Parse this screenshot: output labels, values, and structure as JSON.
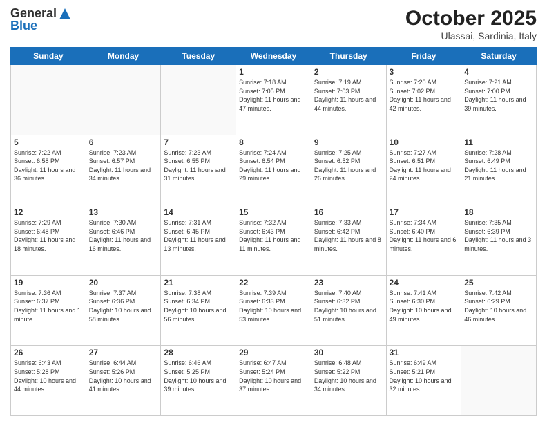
{
  "header": {
    "logo_general": "General",
    "logo_blue": "Blue",
    "title": "October 2025",
    "subtitle": "Ulassai, Sardinia, Italy"
  },
  "days_of_week": [
    "Sunday",
    "Monday",
    "Tuesday",
    "Wednesday",
    "Thursday",
    "Friday",
    "Saturday"
  ],
  "weeks": [
    [
      {
        "day": "",
        "info": ""
      },
      {
        "day": "",
        "info": ""
      },
      {
        "day": "",
        "info": ""
      },
      {
        "day": "1",
        "info": "Sunrise: 7:18 AM\nSunset: 7:05 PM\nDaylight: 11 hours and 47 minutes."
      },
      {
        "day": "2",
        "info": "Sunrise: 7:19 AM\nSunset: 7:03 PM\nDaylight: 11 hours and 44 minutes."
      },
      {
        "day": "3",
        "info": "Sunrise: 7:20 AM\nSunset: 7:02 PM\nDaylight: 11 hours and 42 minutes."
      },
      {
        "day": "4",
        "info": "Sunrise: 7:21 AM\nSunset: 7:00 PM\nDaylight: 11 hours and 39 minutes."
      }
    ],
    [
      {
        "day": "5",
        "info": "Sunrise: 7:22 AM\nSunset: 6:58 PM\nDaylight: 11 hours and 36 minutes."
      },
      {
        "day": "6",
        "info": "Sunrise: 7:23 AM\nSunset: 6:57 PM\nDaylight: 11 hours and 34 minutes."
      },
      {
        "day": "7",
        "info": "Sunrise: 7:23 AM\nSunset: 6:55 PM\nDaylight: 11 hours and 31 minutes."
      },
      {
        "day": "8",
        "info": "Sunrise: 7:24 AM\nSunset: 6:54 PM\nDaylight: 11 hours and 29 minutes."
      },
      {
        "day": "9",
        "info": "Sunrise: 7:25 AM\nSunset: 6:52 PM\nDaylight: 11 hours and 26 minutes."
      },
      {
        "day": "10",
        "info": "Sunrise: 7:27 AM\nSunset: 6:51 PM\nDaylight: 11 hours and 24 minutes."
      },
      {
        "day": "11",
        "info": "Sunrise: 7:28 AM\nSunset: 6:49 PM\nDaylight: 11 hours and 21 minutes."
      }
    ],
    [
      {
        "day": "12",
        "info": "Sunrise: 7:29 AM\nSunset: 6:48 PM\nDaylight: 11 hours and 18 minutes."
      },
      {
        "day": "13",
        "info": "Sunrise: 7:30 AM\nSunset: 6:46 PM\nDaylight: 11 hours and 16 minutes."
      },
      {
        "day": "14",
        "info": "Sunrise: 7:31 AM\nSunset: 6:45 PM\nDaylight: 11 hours and 13 minutes."
      },
      {
        "day": "15",
        "info": "Sunrise: 7:32 AM\nSunset: 6:43 PM\nDaylight: 11 hours and 11 minutes."
      },
      {
        "day": "16",
        "info": "Sunrise: 7:33 AM\nSunset: 6:42 PM\nDaylight: 11 hours and 8 minutes."
      },
      {
        "day": "17",
        "info": "Sunrise: 7:34 AM\nSunset: 6:40 PM\nDaylight: 11 hours and 6 minutes."
      },
      {
        "day": "18",
        "info": "Sunrise: 7:35 AM\nSunset: 6:39 PM\nDaylight: 11 hours and 3 minutes."
      }
    ],
    [
      {
        "day": "19",
        "info": "Sunrise: 7:36 AM\nSunset: 6:37 PM\nDaylight: 11 hours and 1 minute."
      },
      {
        "day": "20",
        "info": "Sunrise: 7:37 AM\nSunset: 6:36 PM\nDaylight: 10 hours and 58 minutes."
      },
      {
        "day": "21",
        "info": "Sunrise: 7:38 AM\nSunset: 6:34 PM\nDaylight: 10 hours and 56 minutes."
      },
      {
        "day": "22",
        "info": "Sunrise: 7:39 AM\nSunset: 6:33 PM\nDaylight: 10 hours and 53 minutes."
      },
      {
        "day": "23",
        "info": "Sunrise: 7:40 AM\nSunset: 6:32 PM\nDaylight: 10 hours and 51 minutes."
      },
      {
        "day": "24",
        "info": "Sunrise: 7:41 AM\nSunset: 6:30 PM\nDaylight: 10 hours and 49 minutes."
      },
      {
        "day": "25",
        "info": "Sunrise: 7:42 AM\nSunset: 6:29 PM\nDaylight: 10 hours and 46 minutes."
      }
    ],
    [
      {
        "day": "26",
        "info": "Sunrise: 6:43 AM\nSunset: 5:28 PM\nDaylight: 10 hours and 44 minutes."
      },
      {
        "day": "27",
        "info": "Sunrise: 6:44 AM\nSunset: 5:26 PM\nDaylight: 10 hours and 41 minutes."
      },
      {
        "day": "28",
        "info": "Sunrise: 6:46 AM\nSunset: 5:25 PM\nDaylight: 10 hours and 39 minutes."
      },
      {
        "day": "29",
        "info": "Sunrise: 6:47 AM\nSunset: 5:24 PM\nDaylight: 10 hours and 37 minutes."
      },
      {
        "day": "30",
        "info": "Sunrise: 6:48 AM\nSunset: 5:22 PM\nDaylight: 10 hours and 34 minutes."
      },
      {
        "day": "31",
        "info": "Sunrise: 6:49 AM\nSunset: 5:21 PM\nDaylight: 10 hours and 32 minutes."
      },
      {
        "day": "",
        "info": ""
      }
    ]
  ]
}
